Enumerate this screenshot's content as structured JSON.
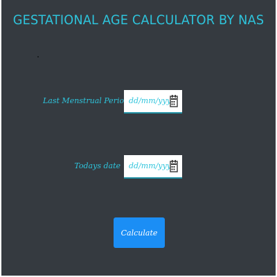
{
  "header": {
    "title": "GESTATIONAL AGE CALCULATOR BY NAS"
  },
  "form": {
    "lmp": {
      "label": "Last Menstrual Period",
      "placeholder": "dd/mm/yyyy",
      "icon": "calendar-icon"
    },
    "today": {
      "label": "Todays date",
      "placeholder": "dd/mm/yyyy",
      "icon": "calendar-icon"
    },
    "calculate_label": "Calculate"
  },
  "colors": {
    "background": "#353a40",
    "accent": "#2ec4dc",
    "button": "#1b8ef5"
  }
}
